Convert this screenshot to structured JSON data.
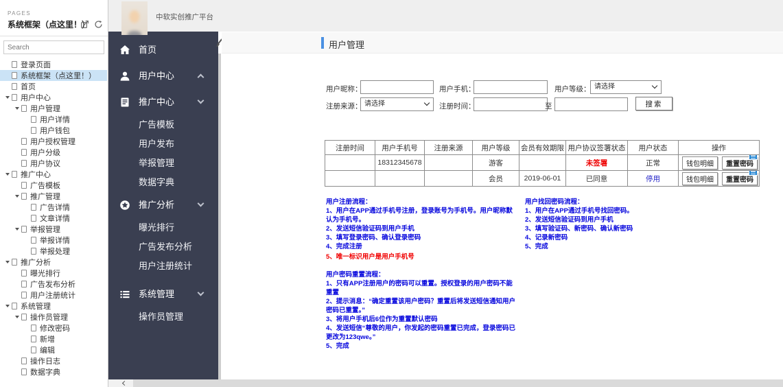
{
  "colors": {
    "sidebar_dark": "#3a3f51",
    "accent_blue": "#4a90e2",
    "note_blue": "#0606dd",
    "warning_red": "#f00000",
    "status_blue": "#2424c8",
    "annotation_blue": "#1e83d3",
    "tree_selected_bg": "#cbe3f6"
  },
  "pages_panel": {
    "heading": "PAGES",
    "title": "系统框架（点这里！）",
    "search_placeholder": "Search",
    "icons": [
      "open-in-window-icon",
      "refresh-icon"
    ],
    "tree": [
      {
        "label": "登录页面",
        "level": 1,
        "expandable": false,
        "selected": false
      },
      {
        "label": "系统框架（点这里！）",
        "level": 1,
        "expandable": false,
        "selected": true
      },
      {
        "label": "首页",
        "level": 1,
        "expandable": false,
        "selected": false
      },
      {
        "label": "用户中心",
        "level": 1,
        "expandable": true,
        "selected": false
      },
      {
        "label": "用户管理",
        "level": 2,
        "expandable": true,
        "selected": false
      },
      {
        "label": "用户详情",
        "level": 3,
        "expandable": false,
        "selected": false
      },
      {
        "label": "用户钱包",
        "level": 3,
        "expandable": false,
        "selected": false
      },
      {
        "label": "用户授权管理",
        "level": 2,
        "expandable": false,
        "selected": false
      },
      {
        "label": "用户分级",
        "level": 2,
        "expandable": false,
        "selected": false
      },
      {
        "label": "用户协议",
        "level": 2,
        "expandable": false,
        "selected": false
      },
      {
        "label": "推广中心",
        "level": 1,
        "expandable": true,
        "selected": false
      },
      {
        "label": "广告模板",
        "level": 2,
        "expandable": false,
        "selected": false
      },
      {
        "label": "推广管理",
        "level": 2,
        "expandable": true,
        "selected": false
      },
      {
        "label": "广告详情",
        "level": 3,
        "expandable": false,
        "selected": false
      },
      {
        "label": "文章详情",
        "level": 3,
        "expandable": false,
        "selected": false
      },
      {
        "label": "举报管理",
        "level": 2,
        "expandable": true,
        "selected": false
      },
      {
        "label": "举报详情",
        "level": 3,
        "expandable": false,
        "selected": false
      },
      {
        "label": "举报处理",
        "level": 3,
        "expandable": false,
        "selected": false
      },
      {
        "label": "推广分析",
        "level": 1,
        "expandable": true,
        "selected": false
      },
      {
        "label": "曝光排行",
        "level": 2,
        "expandable": false,
        "selected": false
      },
      {
        "label": "广告发布分析",
        "level": 2,
        "expandable": false,
        "selected": false
      },
      {
        "label": "用户注册统计",
        "level": 2,
        "expandable": false,
        "selected": false
      },
      {
        "label": "系统管理",
        "level": 1,
        "expandable": true,
        "selected": false
      },
      {
        "label": "操作员管理",
        "level": 2,
        "expandable": true,
        "selected": false
      },
      {
        "label": "修改密码",
        "level": 3,
        "expandable": false,
        "selected": false
      },
      {
        "label": "新增",
        "level": 3,
        "expandable": false,
        "selected": false
      },
      {
        "label": "编辑",
        "level": 3,
        "expandable": false,
        "selected": false
      },
      {
        "label": "操作日志",
        "level": 2,
        "expandable": false,
        "selected": false
      },
      {
        "label": "数据字典",
        "level": 2,
        "expandable": false,
        "selected": false
      }
    ]
  },
  "topbar": {
    "app_title": "中软实创推广平台"
  },
  "nav": {
    "items": [
      {
        "label": "首页",
        "icon": "home-icon"
      },
      {
        "label": "用户中心",
        "icon": "user-icon",
        "state": "collapsed"
      },
      {
        "label": "推广中心",
        "icon": "document-icon",
        "state": "expanded",
        "children": [
          {
            "label": "广告模板"
          },
          {
            "label": "用户发布"
          },
          {
            "label": "举报管理"
          },
          {
            "label": "数据字典"
          }
        ]
      },
      {
        "label": "推广分析",
        "icon": "star-circle-icon",
        "state": "expanded",
        "children": [
          {
            "label": "曝光排行"
          },
          {
            "label": "广告发布分析"
          },
          {
            "label": "用户注册统计"
          }
        ]
      },
      {
        "label": "系统管理",
        "icon": "list-icon",
        "state": "expanded",
        "children": [
          {
            "label": "操作员管理"
          }
        ]
      }
    ]
  },
  "main": {
    "page_title": "用户管理",
    "form": {
      "nickname_label": "用户昵称：",
      "phone_label": "用户手机：",
      "level_label": "用户等级：",
      "source_label": "注册来源：",
      "time_label": "注册时间：",
      "to_label": "至",
      "select_placeholder": "请选择",
      "search_button": "搜索"
    },
    "table": {
      "columns": [
        "注册时间",
        "用户手机号",
        "注册来源",
        "用户等级",
        "会员有效期限",
        "用户协议签署状态",
        "用户状态",
        "操作"
      ],
      "rows": [
        {
          "reg_time": "",
          "phone": "18312345678",
          "source": "",
          "level": "游客",
          "valid": "",
          "agreement": "未签署",
          "status": "正常"
        },
        {
          "reg_time": "",
          "phone": "",
          "source": "",
          "level": "会员",
          "valid": "2019-06-01",
          "agreement": "已同意",
          "status": "停用"
        }
      ],
      "wallet_button": "钱包明细",
      "reset_button": "重置密码"
    },
    "notes": {
      "register": {
        "lines": [
          "用户注册流程：",
          "1、用户在APP通过手机号注册，登录账号为手机号。用户昵称默",
          "认为手机号。",
          "2、发送短信验证码到用户手机",
          "3、填写登录密码、确认登录密码",
          "4、完成注册"
        ],
        "warning": "5、唯一标识用户是用户手机号"
      },
      "retrieve": {
        "lines": [
          "用户找回密码流程：",
          "1、用户在APP通过手机号找回密码。",
          "2、发送短信验证码到用户手机",
          "3、填写验证码、新密码、确认新密码",
          "4、记录新密码",
          "5、完成"
        ]
      },
      "reset": {
        "lines": [
          "用户密码重置流程：",
          "1、只有APP注册用户的密码可以重置。授权登录的用户密码不能",
          "重置",
          "2、提示消息：“确定重置该用户密码？重置后将发送短信通知用户",
          "密码已重置。”",
          "3、将用户手机后6位作为重置默认密码",
          "4、发送短信“尊敬的用户，你发起的密码重置已完成，登录密码已",
          "更改为123qwe。”",
          "5、完成"
        ]
      }
    }
  }
}
